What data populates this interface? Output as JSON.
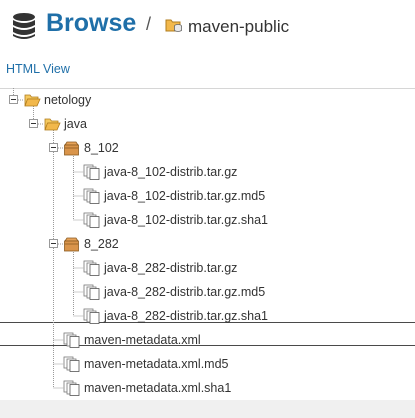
{
  "header": {
    "title": "Browse",
    "separator": "/",
    "repository": "maven-public"
  },
  "view_toggle": {
    "label": "HTML View"
  },
  "tree": {
    "items": [
      {
        "label": "netology",
        "type": "folder-open",
        "level": 1,
        "expanded": true
      },
      {
        "label": "java",
        "type": "folder-open",
        "level": 2,
        "expanded": true
      },
      {
        "label": "8_102",
        "type": "package",
        "level": 3,
        "expanded": true
      },
      {
        "label": "java-8_102-distrib.tar.gz",
        "type": "file",
        "level": 4
      },
      {
        "label": "java-8_102-distrib.tar.gz.md5",
        "type": "file",
        "level": 4
      },
      {
        "label": "java-8_102-distrib.tar.gz.sha1",
        "type": "file",
        "level": 4
      },
      {
        "label": "8_282",
        "type": "package",
        "level": 3,
        "expanded": true,
        "selected": true
      },
      {
        "label": "java-8_282-distrib.tar.gz",
        "type": "file",
        "level": 4
      },
      {
        "label": "java-8_282-distrib.tar.gz.md5",
        "type": "file",
        "level": 4
      },
      {
        "label": "java-8_282-distrib.tar.gz.sha1",
        "type": "file",
        "level": 4
      },
      {
        "label": "maven-metadata.xml",
        "type": "file",
        "level": 3
      },
      {
        "label": "maven-metadata.xml.md5",
        "type": "file",
        "level": 3
      },
      {
        "label": "maven-metadata.xml.sha1",
        "type": "file",
        "level": 3
      }
    ]
  },
  "colors": {
    "accent": "#1f6fa8",
    "folder": "#f2b84b",
    "package": "#d9944a",
    "selection_border": "#4a4a4a"
  }
}
